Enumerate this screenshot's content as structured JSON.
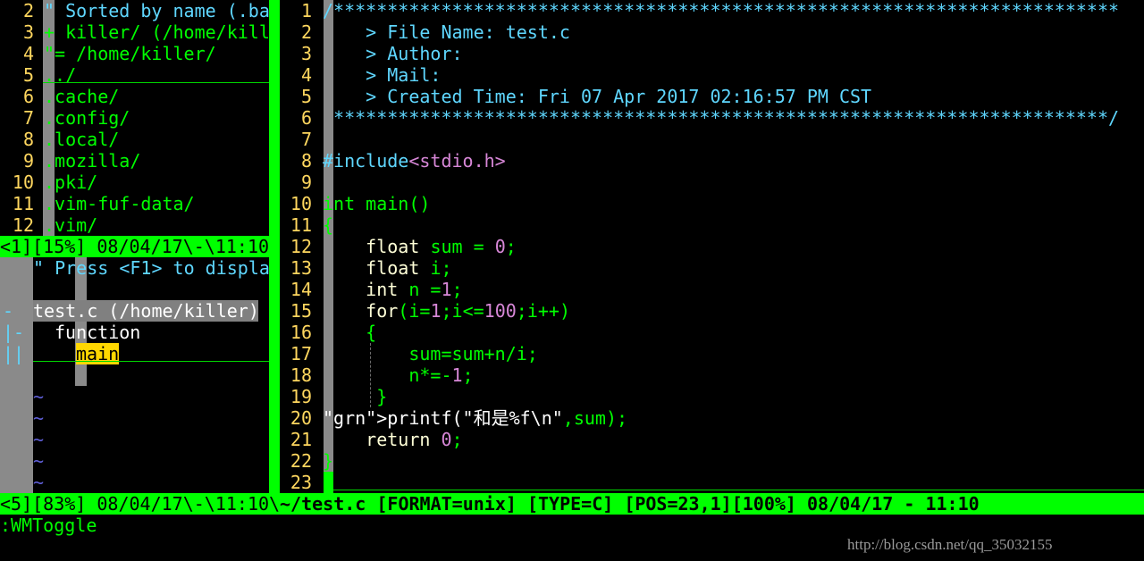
{
  "netrw": {
    "lines": [
      {
        "num": "2",
        "text": "\" Sorted by name (.ba"
      },
      {
        "num": "3",
        "text": "+ killer/ (/home/kill"
      },
      {
        "num": "4",
        "text": "\"= /home/killer/"
      },
      {
        "num": "5",
        "text": "../"
      },
      {
        "num": "6",
        "text": ".cache/"
      },
      {
        "num": "7",
        "text": ".config/"
      },
      {
        "num": "8",
        "text": ".local/"
      },
      {
        "num": "9",
        "text": ".mozilla/"
      },
      {
        "num": "10",
        "text": ".pki/"
      },
      {
        "num": "11",
        "text": ".vim-fuf-data/"
      },
      {
        "num": "12",
        "text": ".vim/"
      }
    ],
    "status": "<1][15%] 08/04/17\\-\\11:10"
  },
  "taglist": {
    "hint": "\" Press <F1> to displa",
    "file_line": "test.c (/home/killer)",
    "file_marker": "-",
    "group_marker": "|-",
    "group": "function",
    "item_marker": "||",
    "item": "main",
    "tilde": "~",
    "status": "<5][83%] 08/04/17\\-\\11:10\\"
  },
  "editor": {
    "lines": [
      {
        "num": "1",
        "text": "/*************************************************************************"
      },
      {
        "num": "2",
        "text": "    > File Name: test.c"
      },
      {
        "num": "3",
        "text": "    > Author:"
      },
      {
        "num": "4",
        "text": "    > Mail:"
      },
      {
        "num": "5",
        "text": "    > Created Time: Fri 07 Apr 2017 02:16:57 PM CST"
      },
      {
        "num": "6",
        "text": " ************************************************************************/"
      },
      {
        "num": "7",
        "text": ""
      },
      {
        "num": "8",
        "text": "#include<stdio.h>"
      },
      {
        "num": "9",
        "text": ""
      },
      {
        "num": "10",
        "text": "int main()"
      },
      {
        "num": "11",
        "text": "{"
      },
      {
        "num": "12",
        "text": "    float sum = 0;"
      },
      {
        "num": "13",
        "text": "    float i;"
      },
      {
        "num": "14",
        "text": "    int n =1;"
      },
      {
        "num": "15",
        "text": "    for(i=1;i<=100;i++)"
      },
      {
        "num": "16",
        "text": "    {"
      },
      {
        "num": "17",
        "text": "        sum=sum+n/i;"
      },
      {
        "num": "18",
        "text": "        n*=-1;"
      },
      {
        "num": "19",
        "text": "     }"
      },
      {
        "num": "20",
        "text": "printf(\"和是%f\\n\",sum);"
      },
      {
        "num": "21",
        "text": "    return 0;"
      },
      {
        "num": "22",
        "text": "}"
      },
      {
        "num": "23",
        "text": ""
      }
    ],
    "status": "~/test.c [FORMAT=unix] [TYPE=C] [POS=23,1][100%] 08/04/17 - 11:10"
  },
  "cmdline": ":WMToggle",
  "watermark": "http://blog.csdn.net/qq_35032155"
}
